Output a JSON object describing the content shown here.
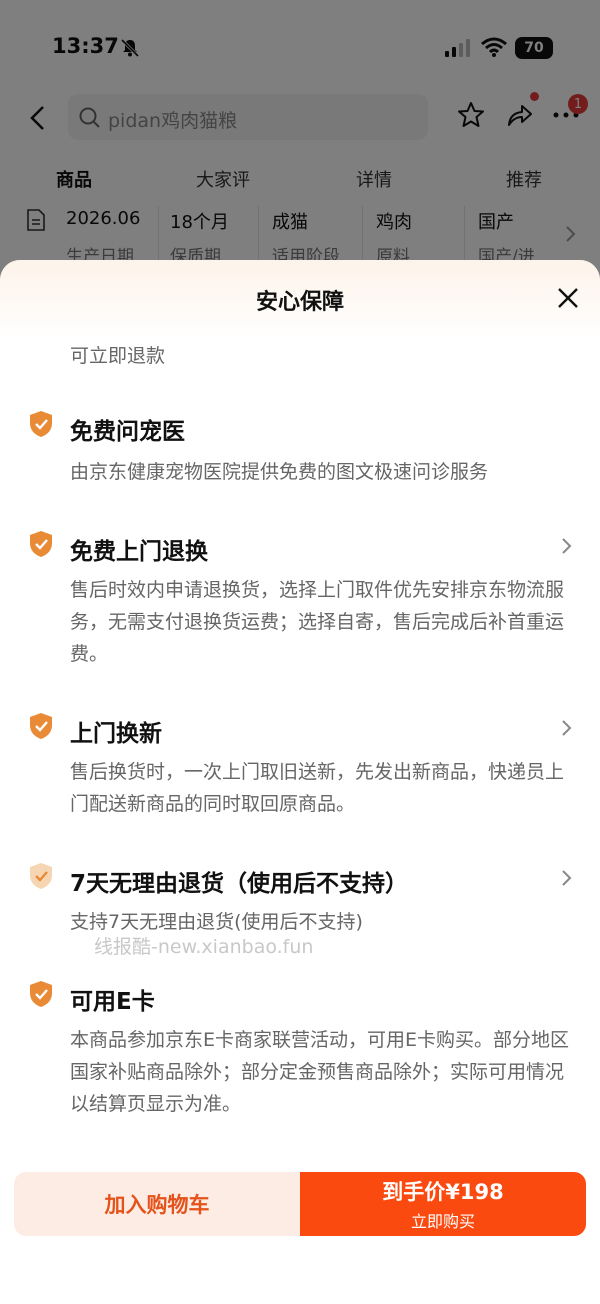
{
  "status": {
    "time": "13:37",
    "battery": "70"
  },
  "search": {
    "query": "pidan鸡肉猫粮"
  },
  "header": {
    "badge_count": "1"
  },
  "tabs": [
    "商品",
    "大家评",
    "详情",
    "推荐"
  ],
  "specs": [
    {
      "value": "2026.06",
      "label": "生产日期"
    },
    {
      "value": "18个月",
      "label": "保质期"
    },
    {
      "value": "成猫",
      "label": "适用阶段"
    },
    {
      "value": "鸡肉",
      "label": "原料"
    },
    {
      "value": "国产",
      "label": "国产/进"
    }
  ],
  "sheet": {
    "title": "安心保障",
    "partial_text": "可立即退款",
    "items": [
      {
        "title": "免费问宠医",
        "desc": "由京东健康宠物医院提供免费的图文极速问诊服务"
      },
      {
        "title": "免费上门退换",
        "desc": "售后时效内申请退换货，选择上门取件优先安排京东物流服务，无需支付退换货运费；选择自寄，售后完成后补首重运费。"
      },
      {
        "title": "上门换新",
        "desc": "售后换货时，一次上门取旧送新，先发出新商品，快递员上门配送新商品的同时取回原商品。"
      },
      {
        "title": "7天无理由退货（使用后不支持）",
        "desc": "支持7天无理由退货(使用后不支持)"
      },
      {
        "title": "可用E卡",
        "desc": "本商品参加京东E卡商家联营活动，可用E卡购买。部分地区国家补贴商品除外；部分定金预售商品除外；实际可用情况以结算页显示为准。"
      }
    ],
    "watermark": "线报酷-new.xianbao.fun"
  },
  "buttons": {
    "cart": "加入购物车",
    "buy_price": "到手价¥198",
    "buy_sub": "立即购买"
  },
  "colors": {
    "accent": "#fb4a10",
    "shield": "#e98a37",
    "cart_bg": "#fdece4"
  }
}
